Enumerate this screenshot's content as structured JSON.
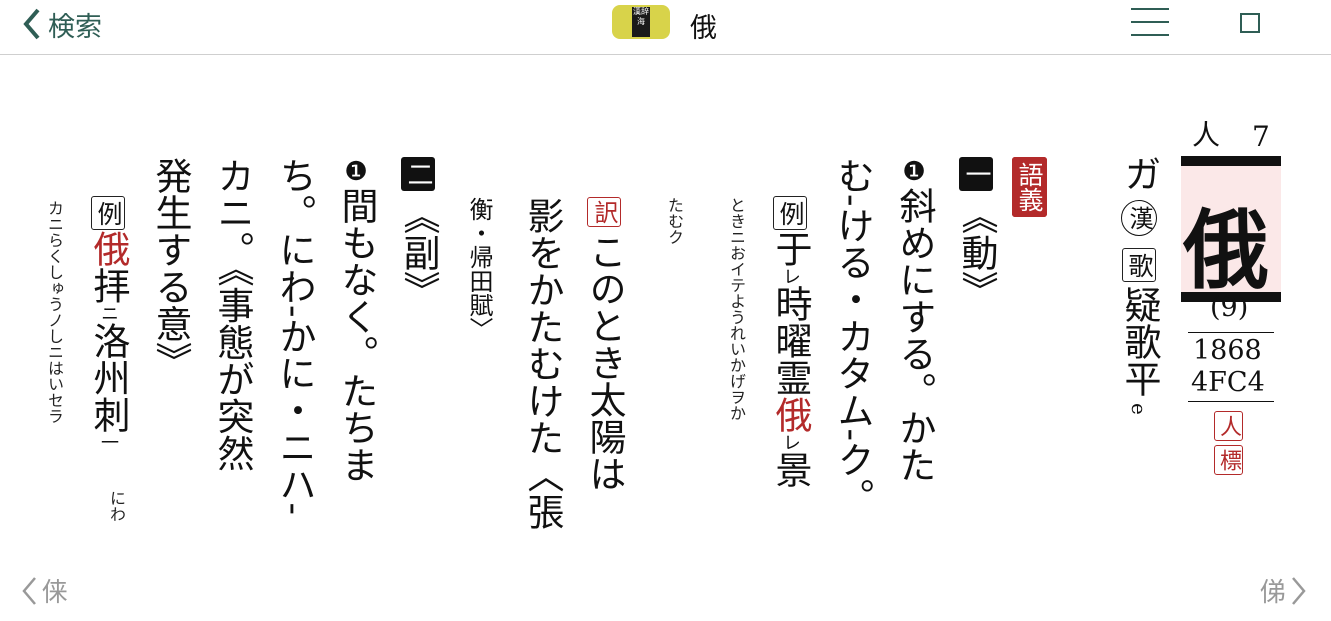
{
  "header": {
    "back_label": "検索",
    "logo_text": "漢辞海",
    "title": "俄"
  },
  "entry": {
    "radical": "人",
    "radical_strokes": "7",
    "headword": "俄",
    "total_strokes": "(9)",
    "code1": "1868",
    "code2": "4FC4",
    "badge1": "人",
    "badge2": "標",
    "reading": "ガ",
    "reading_type": "漢",
    "uta_box": "歌",
    "rhyme": "疑歌平",
    "rhyme_note": "e"
  },
  "body": {
    "gogi": "語義",
    "sec1_mark": "一",
    "sec1_pos": "《動》",
    "s1_num": "❶",
    "s1_line1": "斜めにする。かた",
    "s1_line2": "む-ける・カタム-ク。",
    "rei_box": "例",
    "ex1_text": "于",
    "ex1_ku1": "レ",
    "ex1_text2": "時曜霊",
    "ex1_red": "俄",
    "ex1_ku2": "レ",
    "ex1_text3": "景",
    "ex1_ruby": "ときニおイテようれいかげヲか",
    "ex1_ruby2": "たむク",
    "yaku_box": "訳",
    "tr_line1": "このとき太陽は",
    "tr_line2": "影をかたむけた〈張",
    "tr_line3": "衡・帰田賦〉",
    "sec2_mark": "二",
    "sec2_pos": "《副》",
    "s2_num": "❶",
    "s2_line1": "間もなく。たちま",
    "s2_line2": "ち。にわ-かに・ニハ-",
    "s2_line3": "カニ。《事態が突然",
    "s2_line4": "発生する意》",
    "ex2_red": "俄",
    "ex2_text": "拝",
    "ex2_ku1": "ニ",
    "ex2_text2": "洛州刺",
    "ex2_ku2": "一",
    "ex2_ruby1": "にわ",
    "ex2_ruby2": "カニらくしゅうノしニはいセラ"
  },
  "footer": {
    "prev_char": "俫",
    "next_char": "俤"
  },
  "colors": {
    "accent": "#2f5e55",
    "red": "#b32a2a",
    "logo": "#d8d34a"
  }
}
